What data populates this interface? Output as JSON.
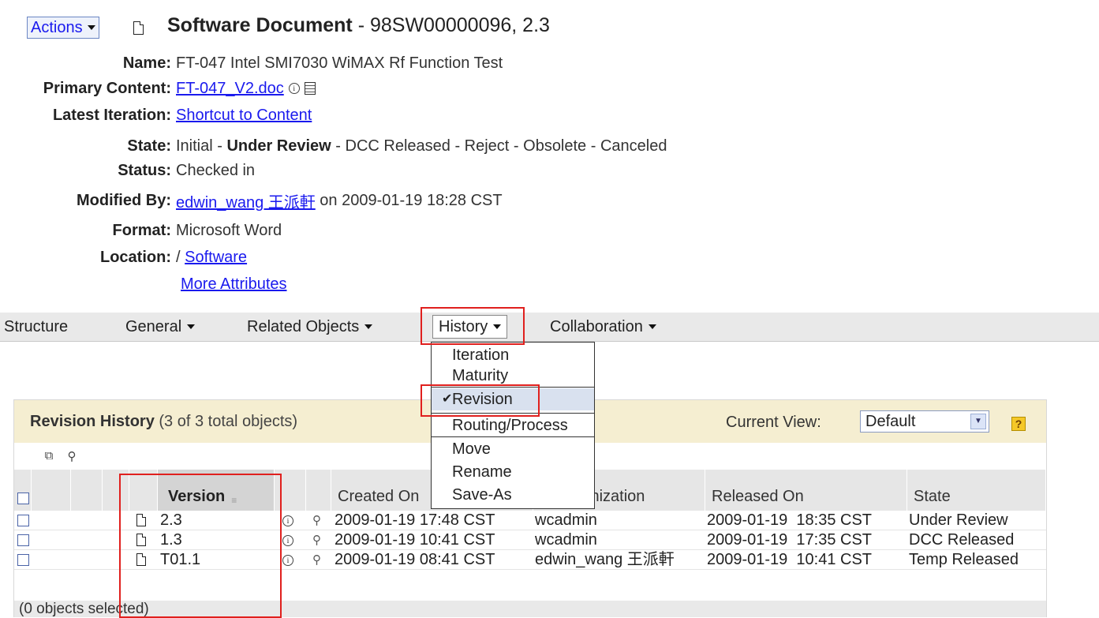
{
  "header": {
    "actions_label": "Actions",
    "title_bold": "Software Document",
    "title_rest": " - 98SW00000096, 2.3"
  },
  "attributes": {
    "name_label": "Name:",
    "name_value": "FT-047 Intel SMI7030 WiMAX Rf Function Test",
    "primary_label": "Primary Content:",
    "primary_value": "FT-047_V2.doc",
    "latest_label": "Latest Iteration:",
    "latest_value": "Shortcut to Content",
    "state_label": "State:",
    "state_pre": "Initial - ",
    "state_current": "Under Review",
    "state_post": " - DCC Released - Reject - Obsolete - Canceled",
    "status_label": "Status:",
    "status_value": "Checked in",
    "modified_label": "Modified By:",
    "modified_user": "edwin_wang 王派軒",
    "modified_rest": " on 2009-01-19 18:28 CST",
    "format_label": "Format:",
    "format_value": "Microsoft Word",
    "location_label": "Location:",
    "location_prefix": "/ ",
    "location_value": "Software",
    "more_attributes": "More Attributes"
  },
  "nav": {
    "structure": "Structure",
    "general": "General",
    "related": "Related Objects",
    "history": "History",
    "collaboration": "Collaboration"
  },
  "history_menu": {
    "iteration": "Iteration",
    "maturity": "Maturity",
    "revision": "Revision",
    "routing": "Routing/Process",
    "move": "Move",
    "rename": "Rename",
    "save_as": "Save-As"
  },
  "panel": {
    "title": "Revision History",
    "count": " (3 of 3 total objects)",
    "current_view_label": "Current View:",
    "current_view_value": "Default",
    "help": "?"
  },
  "table": {
    "col_version": "Version",
    "col_created_on": "Created On",
    "col_organization": "Organization",
    "col_released_on": "Released On",
    "col_state": "State",
    "rows": [
      {
        "version": "2.3",
        "created": "2009-01-19 17:48 CST",
        "org": "wcadmin",
        "released": "2009-01-19  18:35 CST",
        "state": "Under Review"
      },
      {
        "version": "1.3",
        "created": "2009-01-19 10:41 CST",
        "org": "wcadmin",
        "released": "2009-01-19  17:35 CST",
        "state": "DCC Released"
      },
      {
        "version": "T01.1",
        "created": "2009-01-19 08:41 CST",
        "org": "edwin_wang 王派軒",
        "released": "2009-01-19  10:41 CST",
        "state": "Temp Released"
      }
    ],
    "selected_status": "(0 objects selected)"
  }
}
